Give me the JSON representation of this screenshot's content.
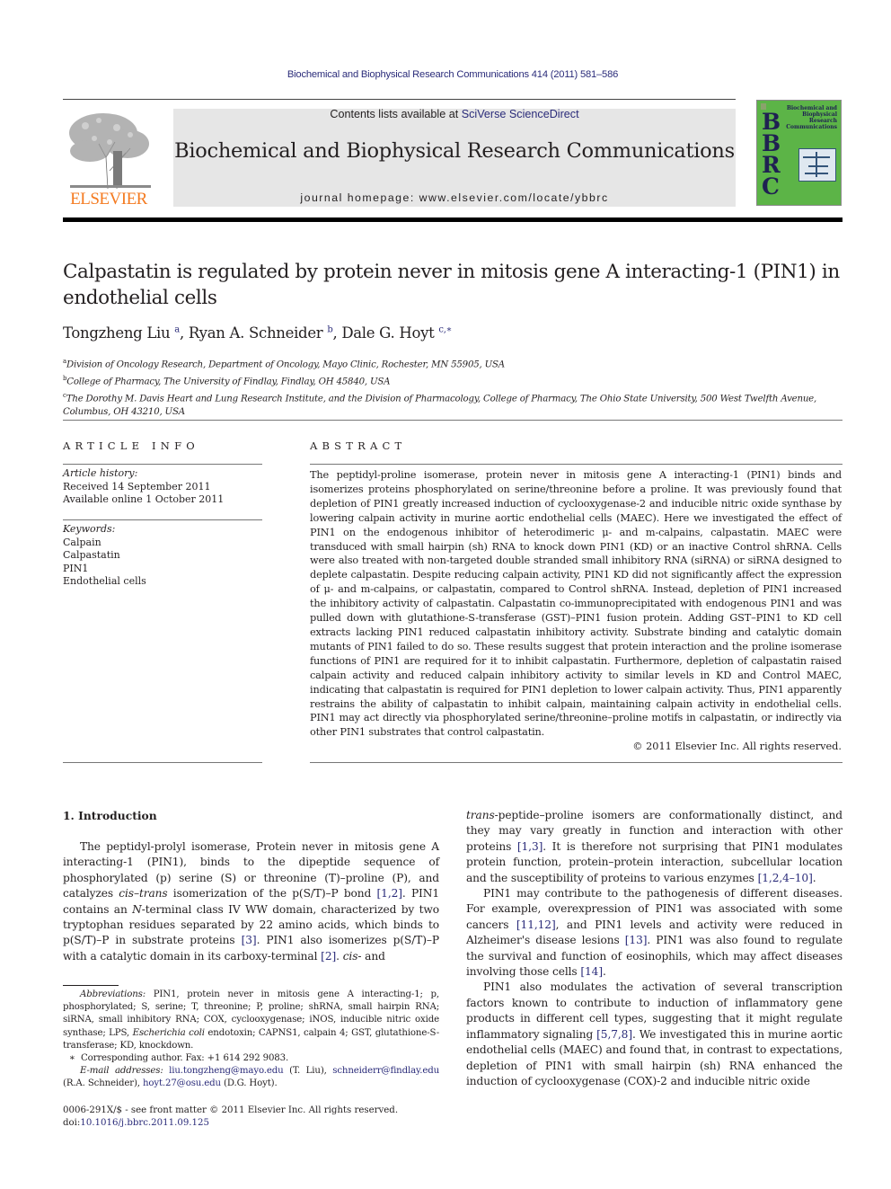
{
  "header": {
    "citation": "Biochemical and Biophysical Research Communications 414 (2011) 581–586",
    "contents_prefix": "Contents lists available at ",
    "contents_link": "SciVerse ScienceDirect",
    "journal_title": "Biochemical and Biophysical Research Communications",
    "homepage_prefix": "journal homepage: ",
    "homepage_url": "www.elsevier.com/locate/ybbrc",
    "publisher_logo_text": "ELSEVIER",
    "cover": {
      "letters": [
        "B",
        "B",
        "R",
        "C"
      ],
      "title_lines": [
        "Biochemical and",
        "Biophysical",
        "Research",
        "Communications"
      ]
    },
    "colors": {
      "elsevier_orange": "#f47a20",
      "cover_green": "#5cb447",
      "link_blue": "#2b2c7a",
      "banner_gray": "#e6e6e6"
    }
  },
  "article": {
    "title": "Calpastatin is regulated by protein never in mitosis gene A interacting-1 (PIN1) in endothelial cells",
    "authors": [
      {
        "name": "Tongzheng Liu",
        "sup": "a",
        "sep": ", "
      },
      {
        "name": "Ryan A. Schneider",
        "sup": "b",
        "sep": ", "
      },
      {
        "name": "Dale G. Hoyt",
        "sup": "c,∗",
        "sep": ""
      }
    ],
    "affiliations": [
      {
        "mark": "a",
        "text": "Division of Oncology Research, Department of Oncology, Mayo Clinic, Rochester, MN 55905, USA"
      },
      {
        "mark": "b",
        "text": "College of Pharmacy, The University of Findlay, Findlay, OH 45840, USA"
      },
      {
        "mark": "c",
        "text": "The Dorothy M. Davis Heart and Lung Research Institute, and the Division of Pharmacology, College of Pharmacy, The Ohio State University, 500 West Twelfth Avenue, Columbus, OH 43210, USA"
      }
    ]
  },
  "article_info": {
    "heading": "ARTICLE INFO",
    "history_label": "Article history:",
    "received": "Received 14 September 2011",
    "available": "Available online 1 October 2011",
    "keywords_label": "Keywords:",
    "keywords": [
      "Calpain",
      "Calpastatin",
      "PIN1",
      "Endothelial cells"
    ]
  },
  "abstract": {
    "heading": "ABSTRACT",
    "text": "The peptidyl-proline isomerase, protein never in mitosis gene A interacting-1 (PIN1) binds and isomerizes proteins phosphorylated on serine/threonine before a proline. It was previously found that depletion of PIN1 greatly increased induction of cyclooxygenase-2 and inducible nitric oxide synthase by lowering calpain activity in murine aortic endothelial cells (MAEC). Here we investigated the effect of PIN1 on the endogenous inhibitor of heterodimeric μ- and m-calpains, calpastatin. MAEC were transduced with small hairpin (sh) RNA to knock down PIN1 (KD) or an inactive Control shRNA. Cells were also treated with non-targeted double stranded small inhibitory RNA (siRNA) or siRNA designed to deplete calpastatin. Despite reducing calpain activity, PIN1 KD did not significantly affect the expression of μ- and m-calpains, or calpastatin, compared to Control shRNA. Instead, depletion of PIN1 increased the inhibitory activity of calpastatin. Calpastatin co-immunoprecipitated with endogenous PIN1 and was pulled down with glutathione-S-transferase (GST)–PIN1 fusion protein. Adding GST–PIN1 to KD cell extracts lacking PIN1 reduced calpastatin inhibitory activity. Substrate binding and catalytic domain mutants of PIN1 failed to do so. These results suggest that protein interaction and the proline isomerase functions of PIN1 are required for it to inhibit calpastatin. Furthermore, depletion of calpastatin raised calpain activity and reduced calpain inhibitory activity to similar levels in KD and Control MAEC, indicating that calpastatin is required for PIN1 depletion to lower calpain activity. Thus, PIN1 apparently restrains the ability of calpastatin to inhibit calpain, maintaining calpain activity in endothelial cells. PIN1 may act directly via phosphorylated serine/threonine–proline motifs in calpastatin, or indirectly via other PIN1 substrates that control calpastatin.",
    "copyright": "© 2011 Elsevier Inc. All rights reserved."
  },
  "body": {
    "section_heading": "1. Introduction",
    "left_col": {
      "p1": [
        {
          "t": "The peptidyl-prolyl isomerase, Protein never in mitosis gene A interacting-1 (PIN1), binds to the dipeptide sequence of phosphorylated (p) serine (S) or threonine (T)–proline (P), and catalyzes "
        },
        {
          "t": "cis–trans",
          "i": true
        },
        {
          "t": " isomerization of the p(S/T)–P bond "
        },
        {
          "t": "[1,2]",
          "ref": true
        },
        {
          "t": ". PIN1 contains an "
        },
        {
          "t": "N",
          "i": true
        },
        {
          "t": "-terminal class IV WW domain, characterized by two tryptophan residues separated by 22 amino acids, which binds to p(S/T)–P in substrate proteins "
        },
        {
          "t": "[3]",
          "ref": true
        },
        {
          "t": ". PIN1 also isomerizes p(S/T)–P with a catalytic domain in its carboxy-terminal "
        },
        {
          "t": "[2]",
          "ref": true
        },
        {
          "t": ". "
        },
        {
          "t": "cis",
          "i": true
        },
        {
          "t": "- and"
        }
      ]
    },
    "right_col": {
      "p1": [
        {
          "t": "trans",
          "i": true
        },
        {
          "t": "-peptide–proline isomers are conformationally distinct, and they may vary greatly in function and interaction with other proteins "
        },
        {
          "t": "[1,3]",
          "ref": true
        },
        {
          "t": ". It is therefore not surprising that PIN1 modulates protein function, protein–protein interaction, subcellular location and the susceptibility of proteins to various enzymes "
        },
        {
          "t": "[1,2,4–10]",
          "ref": true
        },
        {
          "t": "."
        }
      ],
      "p2": [
        {
          "t": "PIN1 may contribute to the pathogenesis of different diseases. For example, overexpression of PIN1 was associated with some cancers "
        },
        {
          "t": "[11,12]",
          "ref": true
        },
        {
          "t": ", and PIN1 levels and activity were reduced in Alzheimer's disease lesions "
        },
        {
          "t": "[13]",
          "ref": true
        },
        {
          "t": ". PIN1 was also found to regulate the survival and function of eosinophils, which may affect diseases involving those cells "
        },
        {
          "t": "[14]",
          "ref": true
        },
        {
          "t": "."
        }
      ],
      "p3": [
        {
          "t": "PIN1 also modulates the activation of several transcription factors known to contribute to induction of inflammatory gene products in different cell types, suggesting that it might regulate inflammatory signaling "
        },
        {
          "t": "[5,7,8]",
          "ref": true
        },
        {
          "t": ". We investigated this in murine aortic endothelial cells (MAEC) and found that, in contrast to expectations, depletion of PIN1 with small hairpin (sh) RNA enhanced the induction of cyclooxygenase (COX)-2 and inducible nitric oxide"
        }
      ]
    }
  },
  "footnotes": {
    "abbrev_label": "Abbreviations:",
    "abbrev_text": " PIN1, protein never in mitosis gene A interacting-1; p, phosphorylated; S, serine; T, threonine; P, proline; shRNA, small hairpin RNA; siRNA, small inhibitory RNA; COX, cyclooxygenase; iNOS, inducible nitric oxide synthase; LPS, ",
    "abbrev_italic": "Escherichia coli",
    "abbrev_text2": " endotoxin; CAPNS1, calpain 4; GST, glutathione-S-transferase; KD, knockdown.",
    "corresponding_mark": "∗",
    "corresponding": "Corresponding author. Fax: +1 614 292 9083.",
    "email_label": "E-mail addresses:",
    "emails": [
      {
        "addr": "liu.tongzheng@mayo.edu",
        "who": " (T. Liu), "
      },
      {
        "addr": "schneiderr@findlay.edu",
        "who": " (R.A. Schneider), "
      },
      {
        "addr": "hoyt.27@osu.edu",
        "who": " (D.G. Hoyt)."
      }
    ],
    "issn": "0006-291X/$ - see front matter © 2011 Elsevier Inc. All rights reserved.",
    "doi_label": "doi:",
    "doi": "10.1016/j.bbrc.2011.09.125"
  }
}
